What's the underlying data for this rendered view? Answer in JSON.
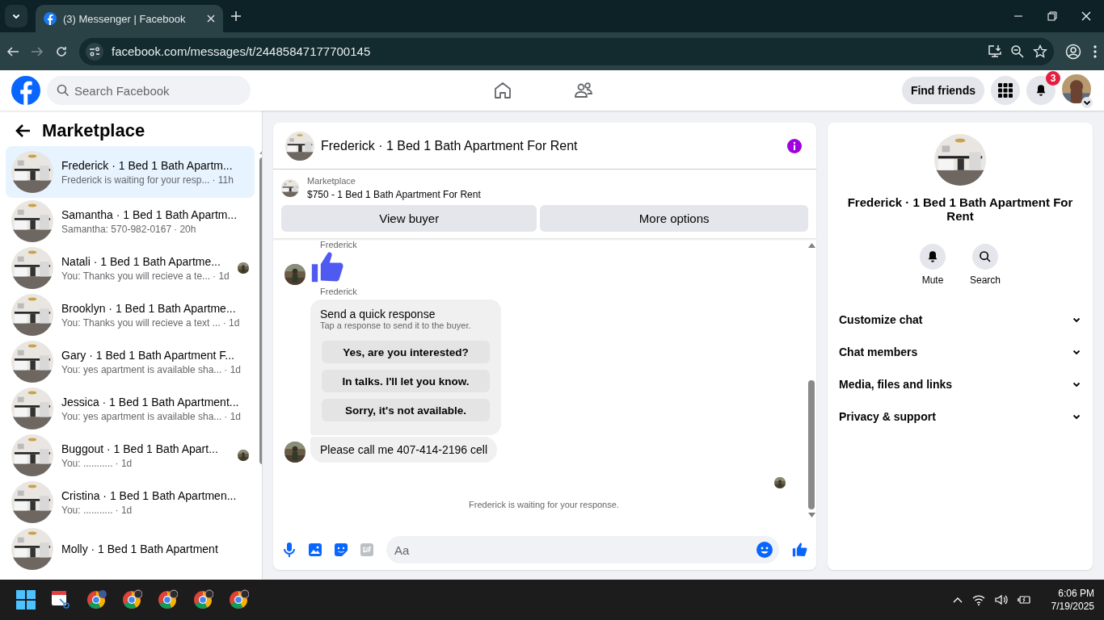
{
  "browser": {
    "tab_title": "(3) Messenger | Facebook",
    "url": "facebook.com/messages/t/24485847177700145"
  },
  "header": {
    "search": {
      "placeholder": "Search Facebook"
    },
    "find_friends": "Find friends",
    "notification_count": "3"
  },
  "sidebar": {
    "title": "Marketplace",
    "conversations": [
      {
        "name": "Frederick · 1 Bed 1 Bath Apartm...",
        "preview": "Frederick is waiting for your resp...",
        "time": "· 11h",
        "selected": true,
        "seen_avatar": false
      },
      {
        "name": "Samantha · 1 Bed 1 Bath Apartm...",
        "preview": "Samantha: 570-982-0167",
        "time": "· 20h",
        "selected": false,
        "seen_avatar": false
      },
      {
        "name": "Natali · 1 Bed 1 Bath Apartme...",
        "preview": "You: Thanks you will recieve a te...",
        "time": "· 1d",
        "selected": false,
        "seen_avatar": true
      },
      {
        "name": "Brooklyn · 1 Bed 1 Bath Apartme...",
        "preview": "You: Thanks you will recieve a text ...",
        "time": "· 1d",
        "selected": false,
        "seen_avatar": false
      },
      {
        "name": "Gary · 1 Bed 1 Bath Apartment F...",
        "preview": "You: yes apartment is available sha...",
        "time": "· 1d",
        "selected": false,
        "seen_avatar": false
      },
      {
        "name": "Jessica · 1 Bed 1 Bath Apartment...",
        "preview": "You: yes apartment is available sha...",
        "time": "· 1d",
        "selected": false,
        "seen_avatar": false
      },
      {
        "name": "Buggout · 1 Bed 1 Bath Apart...",
        "preview": "You: ...........",
        "time": "· 1d",
        "selected": false,
        "seen_avatar": true
      },
      {
        "name": "Cristina · 1 Bed 1 Bath Apartmen...",
        "preview": "You: ...........",
        "time": "· 1d",
        "selected": false,
        "seen_avatar": false
      },
      {
        "name": "Molly · 1 Bed 1 Bath Apartment",
        "selected": false,
        "seen_avatar": false
      }
    ]
  },
  "chat": {
    "title": "Frederick · 1 Bed 1 Bath Apartment For Rent",
    "listing": {
      "label": "Marketplace",
      "title": "$750 - 1 Bed 1 Bath Apartment For Rent"
    },
    "buttons": [
      "View buyer",
      "More options"
    ],
    "messages": [
      {
        "kind": "sender",
        "text": "Frederick"
      },
      {
        "kind": "like"
      },
      {
        "kind": "sender",
        "text": "Frederick"
      },
      {
        "kind": "quick_response",
        "title": "Send a quick response",
        "subtitle": "Tap a response to send it to the buyer.",
        "options": [
          "Yes, are you interested?",
          "In talks. I'll let you know.",
          "Sorry, it's not available."
        ]
      },
      {
        "kind": "text",
        "text": "Please call me 407-414-2196 cell"
      },
      {
        "kind": "seen"
      },
      {
        "kind": "status",
        "text": "Frederick is waiting for your response."
      }
    ],
    "composer": {
      "placeholder": "Aa"
    }
  },
  "details": {
    "name": "Frederick · 1 Bed 1 Bath Apartment For Rent",
    "actions": [
      {
        "kind": "mute",
        "label": "Mute"
      },
      {
        "kind": "search",
        "label": "Search"
      }
    ],
    "sections": [
      "Customize chat",
      "Chat members",
      "Media, files and links",
      "Privacy & support"
    ]
  },
  "taskbar": {
    "time": "6:06 PM",
    "date": "7/19/2025"
  }
}
